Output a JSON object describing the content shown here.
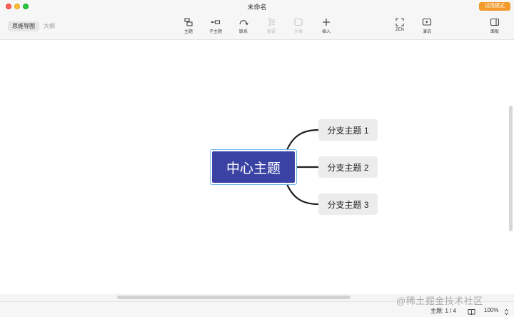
{
  "window": {
    "title": "未命名",
    "trial_button": "试用模式"
  },
  "view_tabs": [
    {
      "label": "思维导图"
    },
    {
      "label": "大纲"
    }
  ],
  "toolbar": {
    "topic": "主题",
    "subtopic": "子主题",
    "relationship": "联系",
    "summary": "概要",
    "boundary": "外框",
    "insert": "插入",
    "zen": "ZEN",
    "present": "演说",
    "panel": "面板"
  },
  "mindmap": {
    "central_topic": "中心主题",
    "branches": [
      {
        "label": "分支主题 1"
      },
      {
        "label": "分支主题 2"
      },
      {
        "label": "分支主题 3"
      }
    ]
  },
  "status": {
    "topic_count": "主题: 1 / 4",
    "zoom": "100%",
    "watermark": "@稀土掘金技术社区"
  },
  "colors": {
    "central_fill": "#3a43a3",
    "branch_fill": "#ececec",
    "connector": "#1f1f1f",
    "trial_accent": "#f39a2b",
    "selection": "#6fb5e8"
  }
}
